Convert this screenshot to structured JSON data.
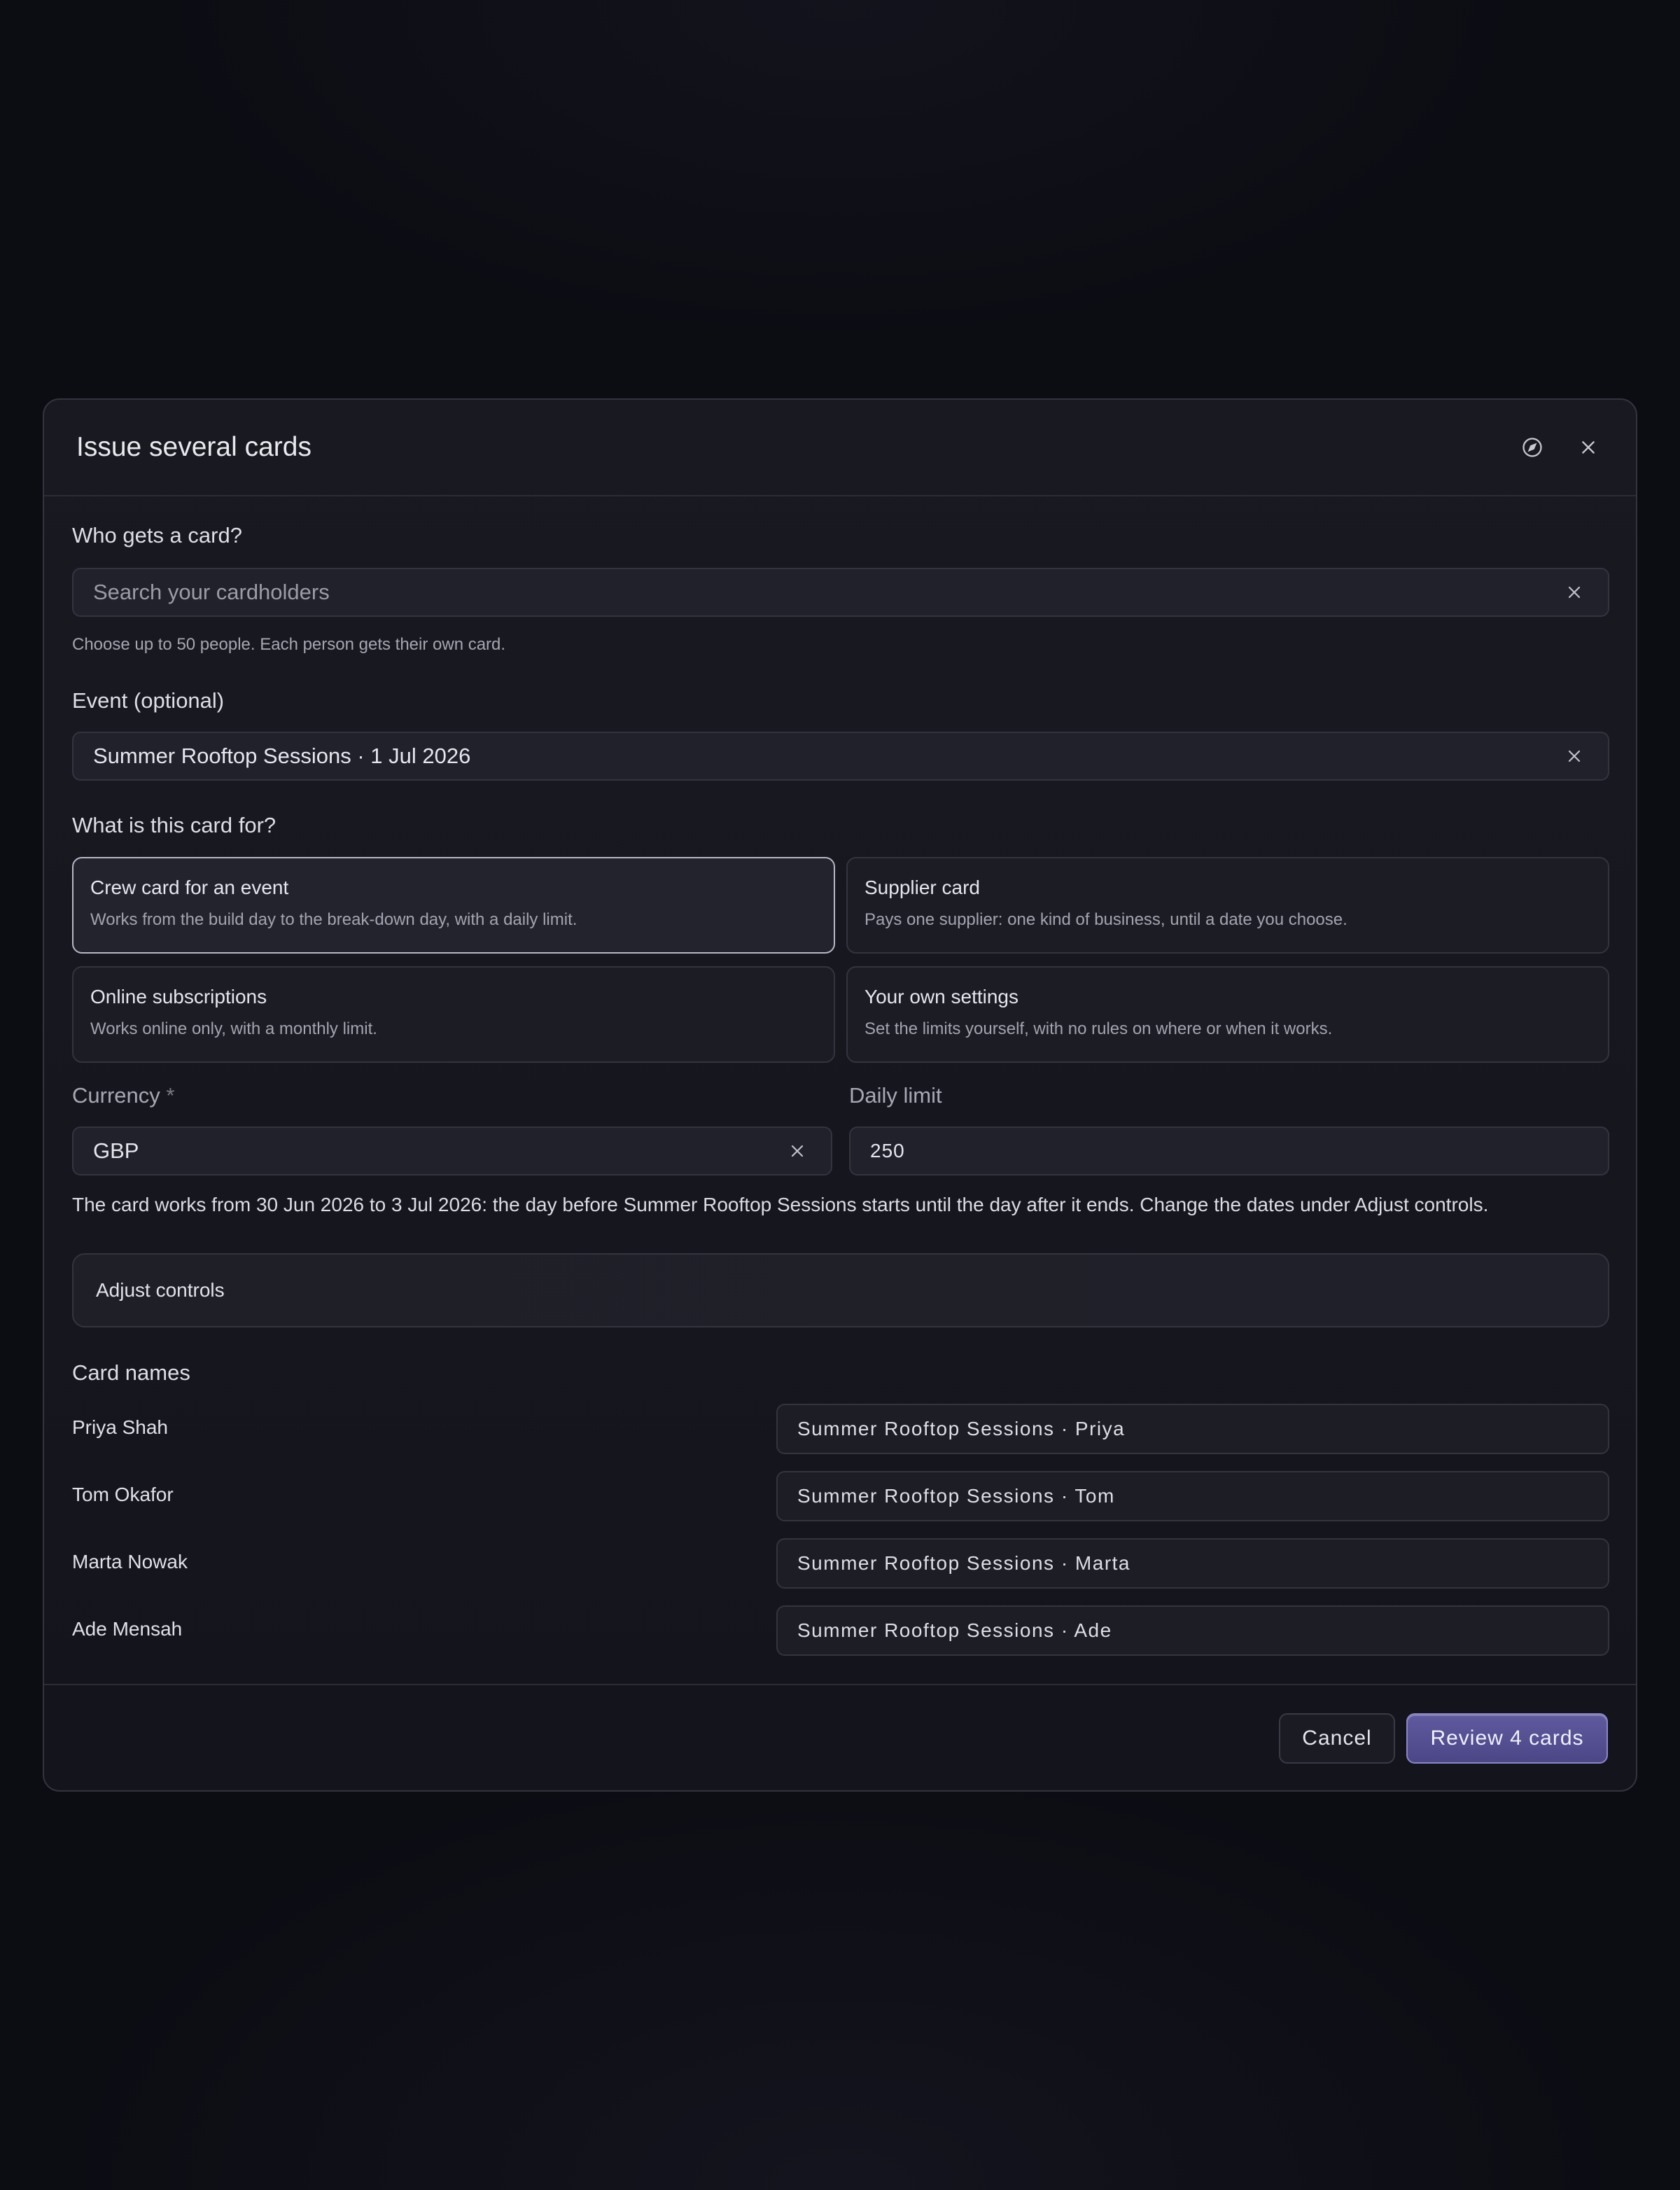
{
  "modal": {
    "title": "Issue several cards"
  },
  "cardholders": {
    "label": "Who gets a card?",
    "placeholder": "Search your cardholders",
    "hint": "Choose up to 50 people. Each person gets their own card."
  },
  "event": {
    "label": "Event (optional)",
    "value": "Summer Rooftop Sessions · 1 Jul 2026"
  },
  "purpose": {
    "label": "What is this card for?",
    "options": [
      {
        "title": "Crew card for an event",
        "desc": "Works from the build day to the break-down day, with a daily limit.",
        "selected": true
      },
      {
        "title": "Supplier card",
        "desc": "Pays one supplier: one kind of business, until a date you choose.",
        "selected": false
      },
      {
        "title": "Online subscriptions",
        "desc": "Works online only, with a monthly limit.",
        "selected": false
      },
      {
        "title": "Your own settings",
        "desc": "Set the limits yourself, with no rules on where or when it works.",
        "selected": false
      }
    ]
  },
  "currency": {
    "label": "Currency",
    "required_mark": "*",
    "value": "GBP"
  },
  "daily_limit": {
    "label": "Daily limit",
    "value": "250"
  },
  "validity_note": "The card works from 30 Jun 2026 to 3 Jul 2026: the day before Summer Rooftop Sessions starts until the day after it ends. Change the dates under Adjust controls.",
  "adjust_controls": {
    "label": "Adjust controls"
  },
  "card_names": {
    "label": "Card names",
    "rows": [
      {
        "person": "Priya Shah",
        "card_name": "Summer Rooftop Sessions · Priya"
      },
      {
        "person": "Tom Okafor",
        "card_name": "Summer Rooftop Sessions · Tom"
      },
      {
        "person": "Marta Nowak",
        "card_name": "Summer Rooftop Sessions · Marta"
      },
      {
        "person": "Ade Mensah",
        "card_name": "Summer Rooftop Sessions · Ade"
      }
    ]
  },
  "footer": {
    "cancel_label": "Cancel",
    "primary_label": "Review 4 cards"
  }
}
